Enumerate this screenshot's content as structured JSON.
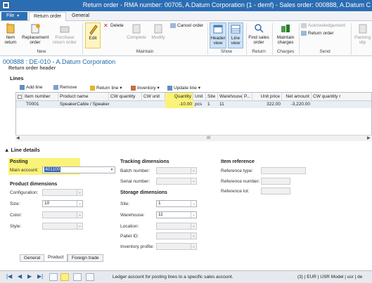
{
  "window": {
    "title": "Return order  -  RMA number: 00705,  A.Datum Corporation (1 - demf) - Sales order: 000888, A.Datum C"
  },
  "tabs": {
    "file": "File",
    "return_order": "Return order",
    "general": "General"
  },
  "ribbon": {
    "item_return": "Item\nreturn",
    "replacement_order": "Replacement\norder",
    "purchase_return_order": "Purchase\nreturn order",
    "edit": "Edit",
    "delete": "Delete",
    "complete": "Complete",
    "modify": "Modify",
    "cancel_order": "Cancel order",
    "header_view": "Header\nview",
    "line_view": "Line\nview",
    "find_sales_order": "Find sales\norder",
    "maintain_charges": "Maintain\ncharges",
    "acknowledgement": "Acknowledgement",
    "return_order_send": "Return order",
    "packing_slip": "Packing\nslip",
    "groups": {
      "new": "New",
      "maintain": "Maintain",
      "show": "Show",
      "return": "Return",
      "charges": "Charges",
      "send": "Send"
    }
  },
  "page": {
    "heading": "000888 : DE-010 - A.Datum Corporation",
    "subheading": "Return order header",
    "lines_label": "Lines"
  },
  "grid_toolbar": {
    "add_line": "Add line",
    "remove": "Remove",
    "return_line": "Return line",
    "inventory": "Inventory",
    "update_line": "Update line"
  },
  "grid": {
    "columns": [
      "Item number",
      "Product name",
      "CW quantity",
      "CW unit",
      "Quantity",
      "Unit",
      "Site",
      "Warehouse",
      "P...",
      "Unit price",
      "Net amount",
      "CW quantity r"
    ],
    "rows": [
      {
        "item_number": "T0001",
        "product_name": "SpeakerCable / Speaker cable...",
        "cw_quantity": "",
        "cw_unit": "",
        "quantity": "-10.00",
        "unit": "pcs",
        "site": "1",
        "warehouse": "11",
        "p": "",
        "unit_price": "322.00",
        "net_amount": "-3,220.00",
        "cw_quantity_r": ""
      }
    ],
    "scroll_mark": "III"
  },
  "line_details": {
    "title": "Line details",
    "posting": {
      "title": "Posting",
      "main_account_label": "Main account:",
      "main_account_value": "401100"
    },
    "product_dimensions": {
      "title": "Product dimensions",
      "configuration_label": "Configuration:",
      "size_label": "Size:",
      "size_value": "10",
      "color_label": "Color:",
      "style_label": "Style:"
    },
    "tracking_dimensions": {
      "title": "Tracking dimensions",
      "batch_label": "Batch number:",
      "serial_label": "Serial number:"
    },
    "storage_dimensions": {
      "title": "Storage dimensions",
      "site_label": "Site:",
      "site_value": "1",
      "warehouse_label": "Warehouse:",
      "warehouse_value": "11",
      "location_label": "Location:",
      "pallet_label": "Pallet ID:",
      "inventory_profile_label": "Inventory profile:"
    },
    "item_reference": {
      "title": "Item reference",
      "type_label": "Reference type:",
      "number_label": "Reference number:",
      "lot_label": "Reference lot:"
    }
  },
  "bottom_tabs": [
    "General",
    "Product",
    "Foreign trade"
  ],
  "status": {
    "message": "Ledger account for posting lines to a specific sales account.",
    "right": "(3)  |  EUR  |  USR Model  |  usr  |  de"
  },
  "colors": {
    "accent": "#2b6db3",
    "highlight": "#fbf27a",
    "heading": "#1f6aa8"
  }
}
